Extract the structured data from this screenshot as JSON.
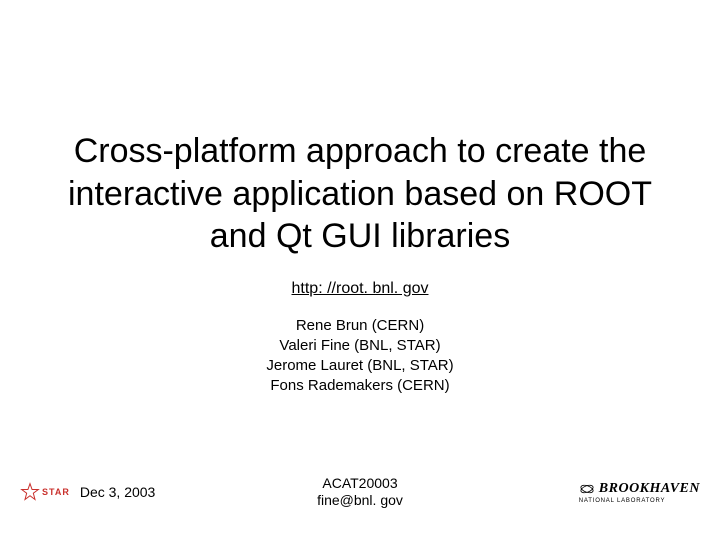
{
  "title": "Cross-platform approach to create the interactive  application based on ROOT and Qt GUI libraries",
  "link": "http: //root. bnl. gov",
  "authors": [
    "Rene Brun (CERN)",
    "Valeri Fine (BNL, STAR)",
    "Jerome Lauret (BNL, STAR)",
    "Fons Rademakers (CERN)"
  ],
  "footer": {
    "date": "Dec 3, 2003",
    "conference": "ACAT20003",
    "email": "fine@bnl. gov",
    "star_label": "STAR",
    "bnl_top": "BROOKHAVEN",
    "bnl_bottom": "NATIONAL LABORATORY"
  }
}
